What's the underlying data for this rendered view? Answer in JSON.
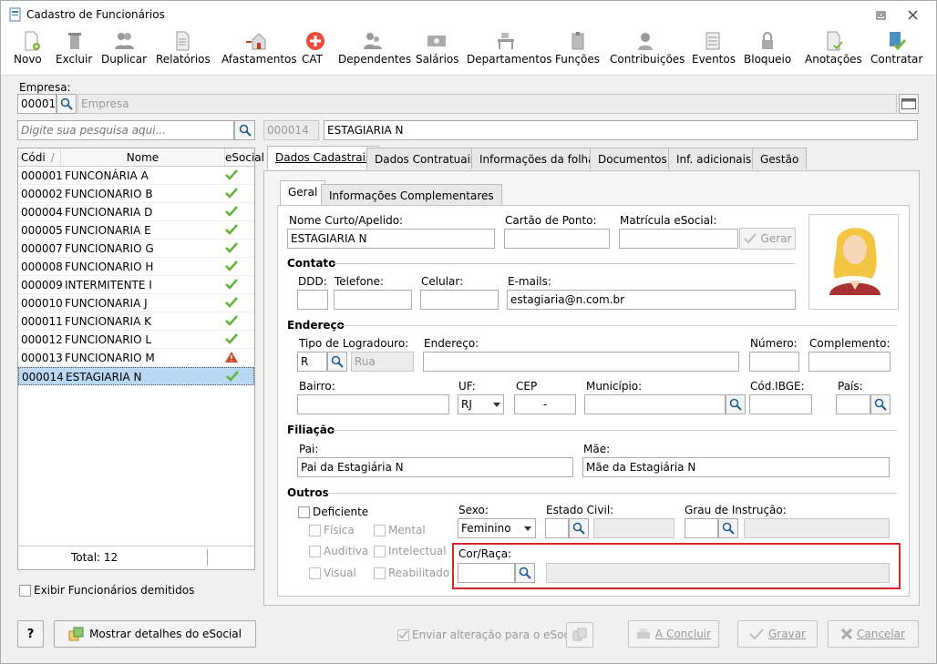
{
  "window": {
    "title": "Cadastro de Funcionários"
  },
  "toolbar": {
    "items": [
      "Novo",
      "Excluir",
      "Duplicar",
      "Relatórios",
      "Afastamentos",
      "CAT",
      "Dependentes",
      "Salários",
      "Departamentos",
      "Funções",
      "Contribuições",
      "Eventos",
      "Bloqueio",
      "Anotações",
      "Contratar"
    ]
  },
  "empresa": {
    "label": "Empresa:",
    "code": "00001",
    "placeholder": "Empresa"
  },
  "search": {
    "placeholder": "Digite sua pesquisa aqui..."
  },
  "header": {
    "code": "000014",
    "name": "ESTAGIARIA N"
  },
  "list": {
    "headers": [
      "Códi",
      "Nome",
      "eSocial"
    ],
    "rows": [
      {
        "code": "000001",
        "name": "FUNCONÁRIA A",
        "status": "ok"
      },
      {
        "code": "000002",
        "name": "FUNCIONARIO B",
        "status": "ok"
      },
      {
        "code": "000004",
        "name": "FUNCIONARIA D",
        "status": "ok"
      },
      {
        "code": "000005",
        "name": "FUNCIONARIA E",
        "status": "ok"
      },
      {
        "code": "000007",
        "name": "FUNCIONARIO G",
        "status": "ok"
      },
      {
        "code": "000008",
        "name": "FUNCIONARIO H",
        "status": "ok"
      },
      {
        "code": "000009",
        "name": "INTERMITENTE I",
        "status": "ok"
      },
      {
        "code": "000010",
        "name": "FUNCIONARIA J",
        "status": "ok"
      },
      {
        "code": "000011",
        "name": "FUNCIONARIA K",
        "status": "ok"
      },
      {
        "code": "000012",
        "name": "FUNCIONARIO L",
        "status": "ok"
      },
      {
        "code": "000013",
        "name": "FUNCIONARIO M",
        "status": "warning"
      },
      {
        "code": "000014",
        "name": "ESTAGIARIA N",
        "status": "ok",
        "selected": true
      }
    ],
    "total": "Total: 12"
  },
  "exibir_demitidos": "Exibir Funcionários demitidos",
  "tabs": [
    "Dados Cadastrais",
    "Dados Contratuais",
    "Informações da folha",
    "Documentos",
    "Inf. adicionais",
    "Gestão"
  ],
  "subtabs": [
    "Geral",
    "Informações Complementares"
  ],
  "form": {
    "nome_curto_label": "Nome Curto/Apelido:",
    "nome_curto": "ESTAGIARIA N",
    "cartao_label": "Cartão de Ponto:",
    "matricula_label": "Matrícula eSocial:",
    "gerar": "Gerar",
    "contato": "Contato",
    "ddd_label": "DDD:",
    "telefone_label": "Telefone:",
    "celular_label": "Celular:",
    "emails_label": "E-mails:",
    "email": "estagiaria@n.com.br",
    "endereco": "Endereço",
    "tipo_log_label": "Tipo de Logradouro:",
    "tipo_log": "R",
    "rua": "Rua",
    "endereco_label": "Endereço:",
    "numero_label": "Número:",
    "complemento_label": "Complemento:",
    "bairro_label": "Bairro:",
    "uf_label": "UF:",
    "uf": "RJ",
    "cep_label": "CEP",
    "cep": "-",
    "municipio_label": "Município:",
    "ibge_label": "Cód.IBGE:",
    "pais_label": "País:",
    "filiacao": "Filiação",
    "pai_label": "Pai:",
    "pai": "Pai da Estagiária N",
    "mae_label": "Mãe:",
    "mae": "Mãe da Estagiária N",
    "outros": "Outros",
    "deficiente": "Deficiente",
    "fisica": "Física",
    "mental": "Mental",
    "auditiva": "Auditiva",
    "intelectual": "Intelectual",
    "visual": "Visual",
    "reabilitado": "Reabilitado",
    "sexo_label": "Sexo:",
    "sexo": "Feminino",
    "estado_civil_label": "Estado Civil:",
    "grau_label": "Grau de Instrução:",
    "cor_label": "Cor/Raça:"
  },
  "footer": {
    "help": "?",
    "mostrar": "Mostrar detalhes do eSocial",
    "enviar": "Enviar alteração para o eSocial",
    "concluir": "A Concluir",
    "gravar": "Gravar",
    "cancelar": "Cancelar"
  },
  "colors": {
    "highlight": "#d9262c",
    "selection": "#b8d8f4",
    "ok": "#5fb535",
    "warning": "#cc4a2a"
  }
}
